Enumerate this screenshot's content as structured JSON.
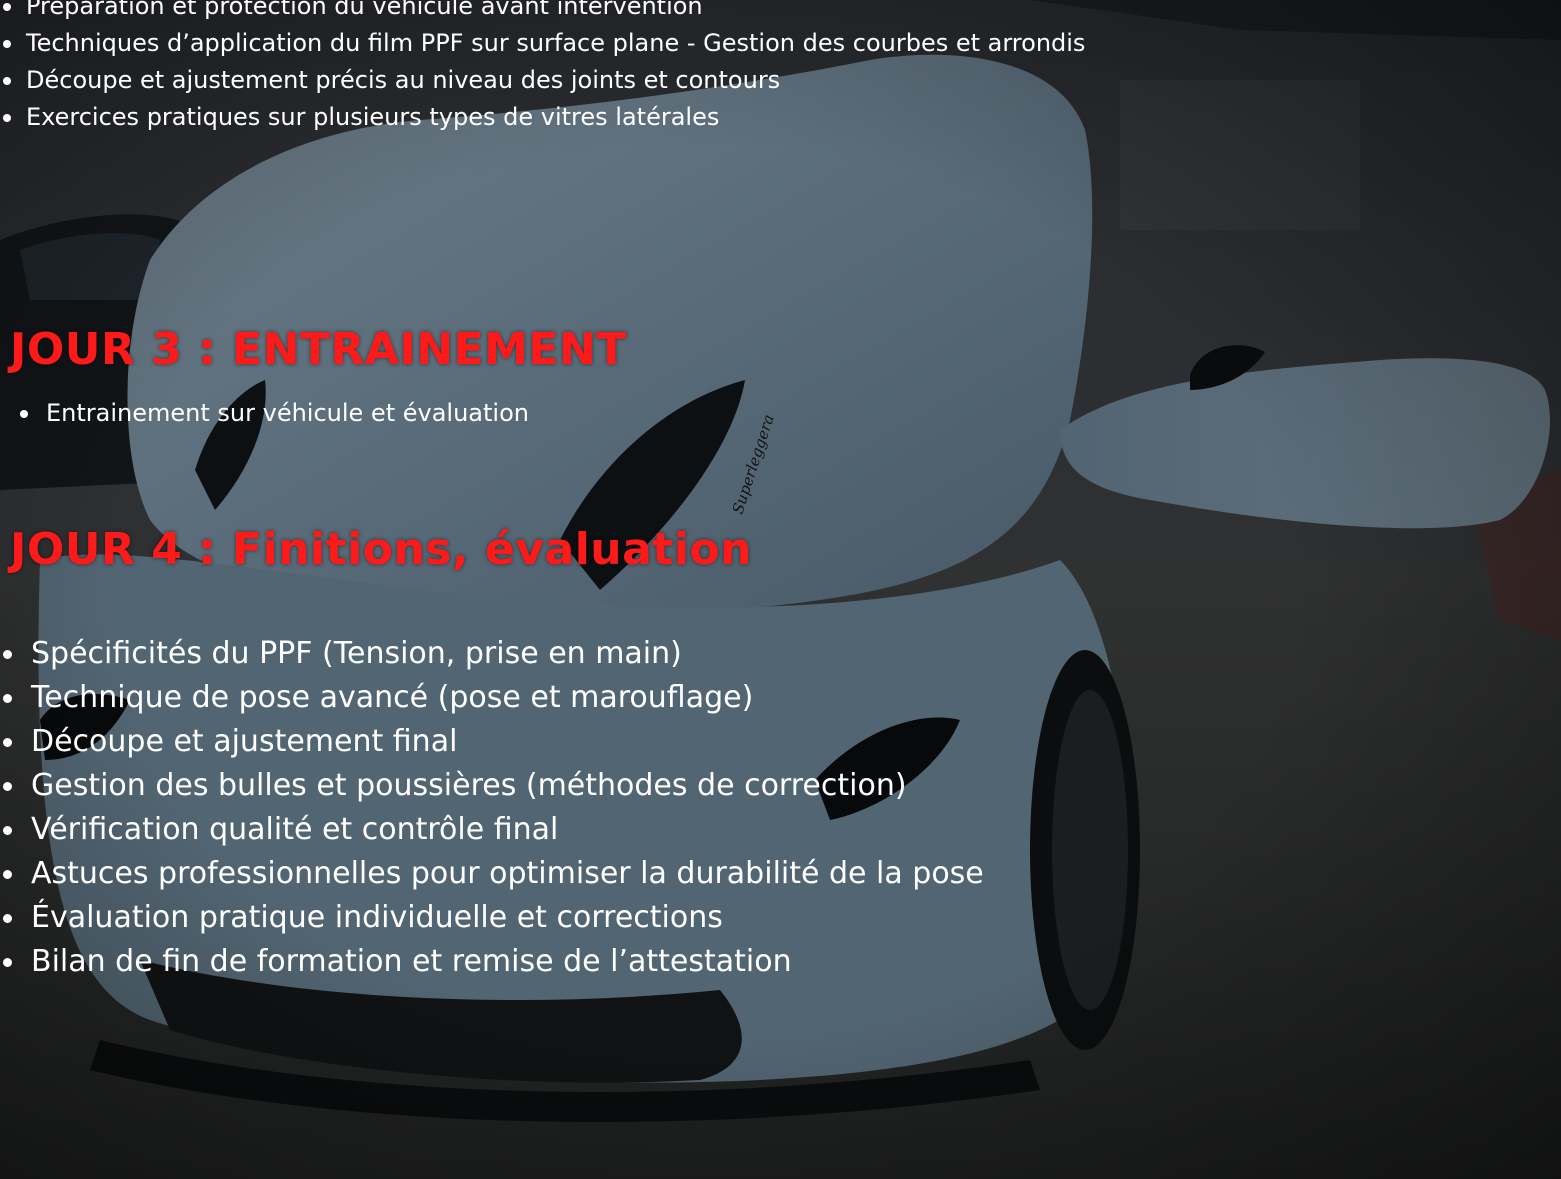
{
  "top_list": {
    "items": [
      "Préparation et protection du véhicule avant intervention",
      "Techniques d’application du film PPF sur surface plane - Gestion des courbes et arrondis",
      "Découpe et ajustement précis au niveau des joints et contours",
      "Exercices pratiques sur plusieurs types de vitres latérales"
    ]
  },
  "day3": {
    "title": "JOUR 3 : ENTRAINEMENT",
    "items": [
      "Entrainement sur véhicule et évaluation"
    ]
  },
  "day4": {
    "title": "JOUR 4 : Finitions, évaluation",
    "items": [
      "Spécificités du PPF (Tension, prise en main)",
      "Technique de pose avancé (pose et marouflage)",
      "Découpe et ajustement final",
      "Gestion des bulles et poussières (méthodes de correction)",
      "Vérification qualité et contrôle final",
      "Astuces professionnelles pour optimiser la durabilité de la pose",
      "Évaluation pratique individuelle et corrections",
      "Bilan de fin de formation et remise de l’attestation"
    ]
  },
  "background": {
    "car_badge": "Superleggera"
  },
  "colors": {
    "heading": "#ff1a1a",
    "text": "#ffffff",
    "car_body": "#8faabd",
    "overlay": "#000000"
  }
}
